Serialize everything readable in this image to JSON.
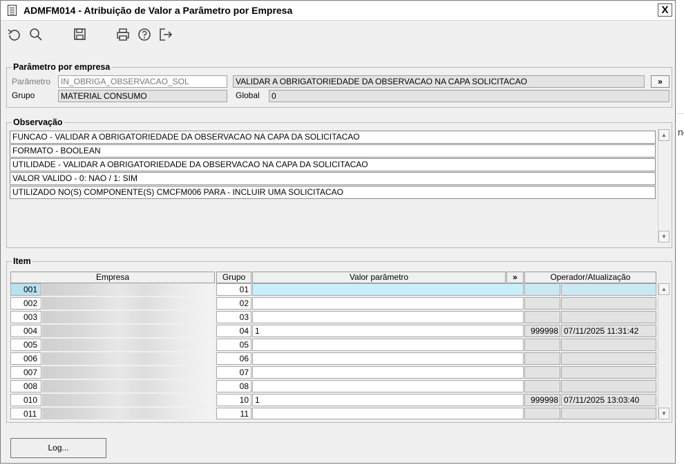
{
  "window": {
    "title": "ADMFM014 - Atribuição de Valor a Parâmetro por Empresa",
    "close_label": "X"
  },
  "toolbar": {
    "icons": [
      "undo-icon",
      "search-icon",
      "save-icon",
      "print-icon",
      "help-icon",
      "exit-icon"
    ]
  },
  "parametro_empresa": {
    "legend": "Parâmetro por empresa",
    "parametro_label": "Parâmetro",
    "parametro_value": "IN_OBRIGA_OBSERVACAO_SOL",
    "descricao_value": "VALIDAR A OBRIGATORIEDADE DA OBSERVACAO NA CAPA SOLICITACAO",
    "more_label": "»",
    "grupo_label": "Grupo",
    "grupo_value": "MATERIAL CONSUMO",
    "global_label": "Global",
    "global_value": "0"
  },
  "observacao": {
    "legend": "Observação",
    "lines": [
      "FUNCAO - VALIDAR A OBRIGATORIEDADE DA OBSERVACAO NA CAPA DA SOLICITACAO",
      "FORMATO - BOOLEAN",
      "UTILIDADE - VALIDAR A OBRIGATORIEDADE DA OBSERVACAO NA CAPA  DA SOLICITACAO",
      "VALOR VALIDO - 0: NAO / 1: SIM",
      "UTILIZADO NO(S) COMPONENTE(S) CMCFM006 PARA  - INCLUIR UMA SOLICITACAO"
    ]
  },
  "item": {
    "legend": "Item",
    "headers": {
      "empresa": "Empresa",
      "grupo": "Grupo",
      "valor": "Valor parâmetro",
      "more": "»",
      "operador": "Operador/Atualização"
    },
    "rows": [
      {
        "num": "001",
        "grupo": "01",
        "valor": "",
        "operador": "",
        "data": ""
      },
      {
        "num": "002",
        "grupo": "02",
        "valor": "",
        "operador": "",
        "data": ""
      },
      {
        "num": "003",
        "grupo": "03",
        "valor": "",
        "operador": "",
        "data": ""
      },
      {
        "num": "004",
        "grupo": "04",
        "valor": "1",
        "operador": "999998",
        "data": "07/11/2025 11:31:42"
      },
      {
        "num": "005",
        "grupo": "05",
        "valor": "",
        "operador": "",
        "data": ""
      },
      {
        "num": "006",
        "grupo": "06",
        "valor": "",
        "operador": "",
        "data": ""
      },
      {
        "num": "007",
        "grupo": "07",
        "valor": "",
        "operador": "",
        "data": ""
      },
      {
        "num": "008",
        "grupo": "08",
        "valor": "",
        "operador": "",
        "data": ""
      },
      {
        "num": "010",
        "grupo": "10",
        "valor": "1",
        "operador": "999998",
        "data": "07/11/2025 13:03:40"
      },
      {
        "num": "011",
        "grupo": "11",
        "valor": "",
        "operador": "",
        "data": ""
      }
    ]
  },
  "footer": {
    "log_label": "Log..."
  },
  "background": {
    "edge_text": "ne"
  }
}
